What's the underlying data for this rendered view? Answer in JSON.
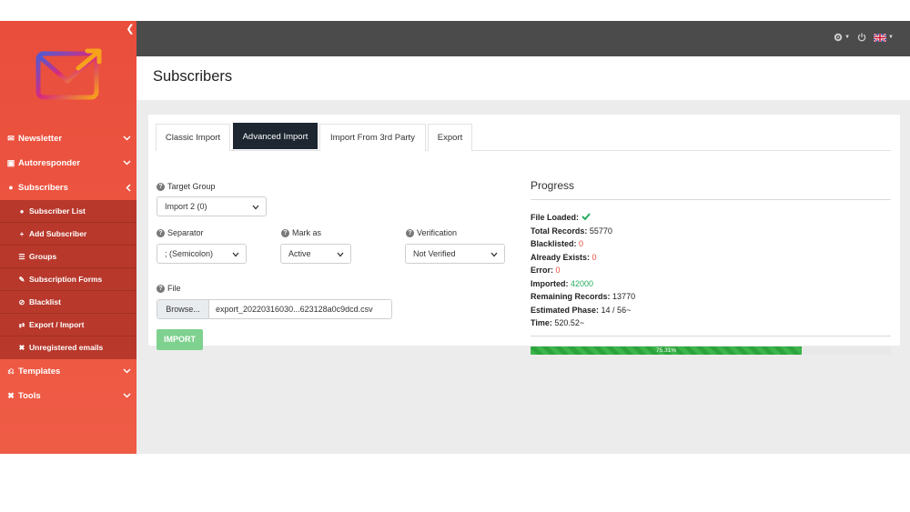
{
  "sidebar": {
    "items": [
      {
        "label": "Newsletter"
      },
      {
        "label": "Autoresponder"
      },
      {
        "label": "Subscribers"
      },
      {
        "label": "Templates"
      },
      {
        "label": "Tools"
      }
    ],
    "subscribers_sub": [
      {
        "label": "Subscriber List"
      },
      {
        "label": "Add Subscriber"
      },
      {
        "label": "Groups"
      },
      {
        "label": "Subscription Forms"
      },
      {
        "label": "Blacklist"
      },
      {
        "label": "Export / Import"
      },
      {
        "label": "Unregistered emails"
      }
    ]
  },
  "header": {
    "title": "Subscribers"
  },
  "tabs": [
    {
      "label": "Classic Import"
    },
    {
      "label": "Advanced Import"
    },
    {
      "label": "Import From 3rd Party"
    },
    {
      "label": "Export"
    }
  ],
  "form": {
    "target_group": {
      "label": "Target Group",
      "value": "Import 2 (0)"
    },
    "separator": {
      "label": "Separator",
      "value": "; (Semicolon)"
    },
    "mark_as": {
      "label": "Mark as",
      "value": "Active"
    },
    "verification": {
      "label": "Verification",
      "value": "Not Verified"
    },
    "file": {
      "label": "File",
      "browse": "Browse...",
      "name": "export_20220316030...623128a0c9dcd.csv"
    },
    "import_button": "IMPORT"
  },
  "progress": {
    "title": "Progress",
    "file_loaded_label": "File Loaded:",
    "total_records_label": "Total Records:",
    "total_records": "55770",
    "blacklisted_label": "Blacklisted:",
    "blacklisted": "0",
    "already_exists_label": "Already Exists:",
    "already_exists": "0",
    "error_label": "Error:",
    "error": "0",
    "imported_label": "Imported:",
    "imported": "42000",
    "remaining_label": "Remaining Records:",
    "remaining": "13770",
    "phase_label": "Estimated Phase:",
    "phase": "14 / 56~",
    "time_label": "Time:",
    "time": "520.52~",
    "percent_text": "75.31%",
    "percent": 75.31
  },
  "colors": {
    "sidebar": "#e94e3c",
    "topbar": "#4b4b4b",
    "active_tab": "#1d2631",
    "success": "#3cb54a",
    "danger": "#e74c3c"
  }
}
